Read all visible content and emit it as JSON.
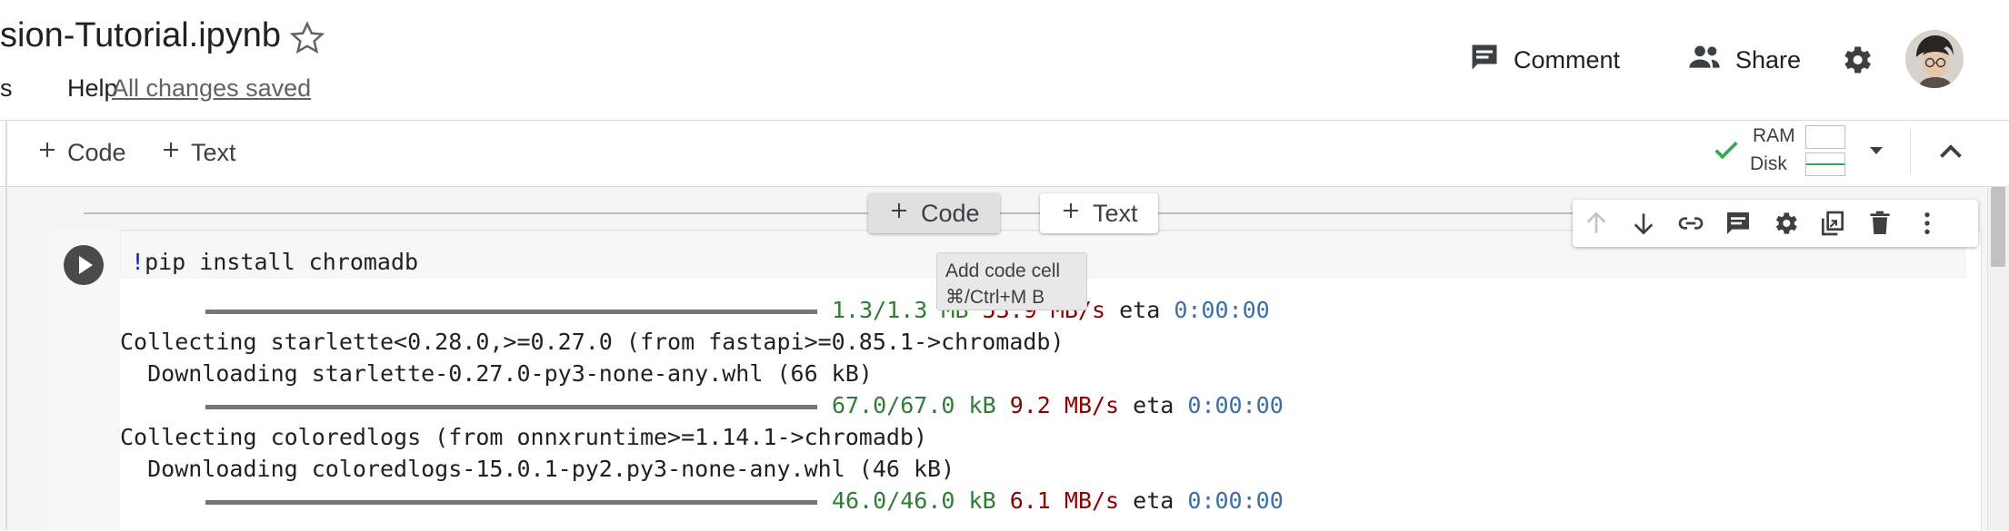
{
  "header": {
    "notebook_title": "sion-Tutorial.ipynb",
    "menu_fragment": "s",
    "menu_help": "Help",
    "save_status": "All changes saved",
    "comment_label": "Comment",
    "share_label": "Share"
  },
  "toolbar": {
    "add_code_label": "Code",
    "add_text_label": "Text",
    "ram_label": "RAM",
    "disk_label": "Disk"
  },
  "insert_bar": {
    "code_label": "Code",
    "text_label": "Text"
  },
  "tooltip": {
    "line1": "Add code cell",
    "line2": "⌘/Ctrl+M B"
  },
  "cell": {
    "code_bang": "!",
    "code_text": "pip install chromadb"
  },
  "output": {
    "clipped_top": "   ━━━━━━━━━━━━━━━━━━━━━━━━━━━━━━━━━━━━━━━━━━━━━━━━━━━━━━━━━━━━━━━━━━━━━━━━━━━━━━━━━",
    "lines": [
      {
        "type": "progress",
        "size": "1.3/1.3 MB",
        "speed": "53.9 MB/s",
        "eta_label": "eta",
        "eta": "0:00:00"
      },
      {
        "type": "text",
        "text": "Collecting starlette<0.28.0,>=0.27.0 (from fastapi>=0.85.1->chromadb)"
      },
      {
        "type": "text",
        "text": "  Downloading starlette-0.27.0-py3-none-any.whl (66 kB)"
      },
      {
        "type": "progress",
        "size": "67.0/67.0 kB",
        "speed": "9.2 MB/s",
        "eta_label": "eta",
        "eta": "0:00:00"
      },
      {
        "type": "text",
        "text": "Collecting coloredlogs (from onnxruntime>=1.14.1->chromadb)"
      },
      {
        "type": "text",
        "text": "  Downloading coloredlogs-15.0.1-py2.py3-none-any.whl (46 kB)"
      },
      {
        "type": "progress",
        "size": "46.0/46.0 kB",
        "speed": "6.1 MB/s",
        "eta_label": "eta",
        "eta": "0:00:00"
      }
    ]
  },
  "colors": {
    "accent_green": "#34a853",
    "size_green": "#2e7d32",
    "speed_red": "#8b0000",
    "eta_blue": "#3b6ea8"
  },
  "icons": [
    "star-outline-icon",
    "comment-icon",
    "share-people-icon",
    "gear-icon",
    "avatar",
    "check-icon",
    "dropdown-icon",
    "chevron-up-icon",
    "run-icon",
    "move-up-icon",
    "move-down-icon",
    "link-icon",
    "comment-icon",
    "settings-icon",
    "mirror-cell-icon",
    "delete-icon",
    "more-vert-icon"
  ]
}
